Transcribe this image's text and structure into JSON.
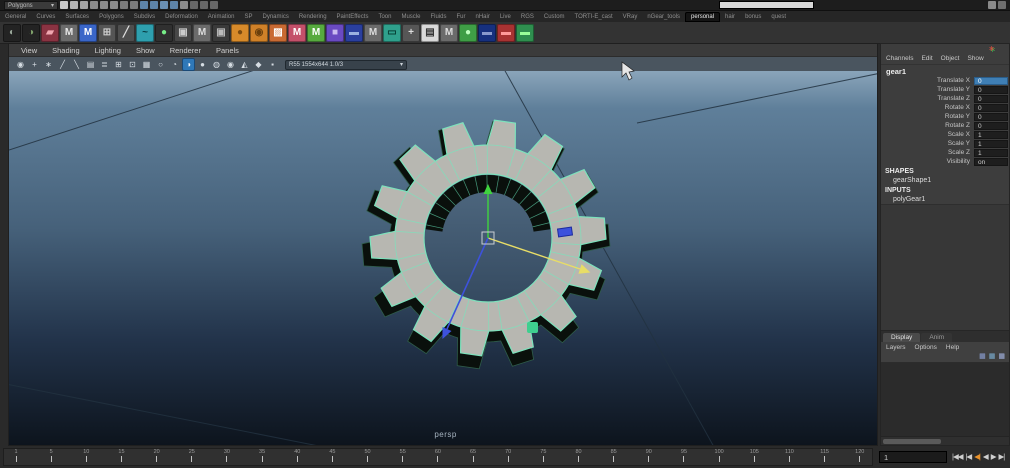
{
  "status_line": {
    "menu_set": "Polygons",
    "caret": "▾",
    "icons": [
      {
        "name": "new-scene-icon",
        "bg": "#c9c9c9"
      },
      {
        "name": "open-scene-icon",
        "bg": "#b5b5b5"
      },
      {
        "name": "save-scene-icon",
        "bg": "#a5a5a5"
      },
      {
        "name": "cut-icon",
        "bg": "#8d8d8d"
      },
      {
        "name": "copy-icon",
        "bg": "#8d8d8d"
      },
      {
        "name": "paste-icon",
        "bg": "#8d8d8d"
      },
      {
        "name": "undo-icon",
        "bg": "#7c7c7c"
      },
      {
        "name": "redo-icon",
        "bg": "#7c7c7c"
      },
      {
        "name": "snap-grid-icon",
        "bg": "#5e84a8"
      },
      {
        "name": "snap-curve-icon",
        "bg": "#5e84a8"
      },
      {
        "name": "snap-point-icon",
        "bg": "#6a8fb2"
      },
      {
        "name": "snap-view-icon",
        "bg": "#5e84a8"
      },
      {
        "name": "construction-history-icon",
        "bg": "#8d8d8d"
      },
      {
        "name": "render-current-icon",
        "bg": "#686868"
      },
      {
        "name": "ipr-render-icon",
        "bg": "#686868"
      },
      {
        "name": "render-settings-icon",
        "bg": "#686868"
      }
    ],
    "field_value": "",
    "right_icons": [
      {
        "name": "sidebar-toggle-icon",
        "bg": "#8a8a8a"
      },
      {
        "name": "hotbox-toggle-icon",
        "bg": "#6f6f6f"
      }
    ]
  },
  "shelf": {
    "tabs": [
      "General",
      "Curves",
      "Surfaces",
      "Polygons",
      "Subdivs",
      "Deformation",
      "Animation",
      "SP",
      "Dynamics",
      "Rendering",
      "PaintEffects",
      "Toon",
      "Muscle",
      "Fluids",
      "Fur",
      "nHair",
      "Live",
      "RGS",
      "Custom",
      "TORTI-E_cast",
      "VRay",
      "nGear_tools",
      "personal",
      "hair",
      "bonus",
      "quest"
    ],
    "active_tab": "personal",
    "icons": [
      {
        "name": "sphere-shelf-icon",
        "bg": "#232323",
        "fg": "#9aa89a",
        "g": "◐"
      },
      {
        "name": "shaded-sphere-shelf-icon",
        "bg": "#232323",
        "fg": "#7fa06a",
        "g": "◑"
      },
      {
        "name": "paint-effects-shelf-icon",
        "bg": "#8a3342",
        "fg": "#f0a6b0",
        "g": "▰"
      },
      {
        "name": "maya-mr-shelf-icon",
        "bg": "#6b6b6b",
        "fg": "#e8e8e8",
        "g": "M"
      },
      {
        "name": "maya-blue-shelf-icon",
        "bg": "#3a66c8",
        "fg": "#ffffff",
        "g": "M"
      },
      {
        "name": "grid-shelf-icon",
        "bg": "#555555",
        "fg": "#cccccc",
        "g": "⊞"
      },
      {
        "name": "pen-shelf-icon",
        "bg": "#4e4e4e",
        "fg": "#dddddd",
        "g": "╱"
      },
      {
        "name": "curve-shelf-icon",
        "bg": "#2e9fae",
        "fg": "#073a40",
        "g": "~"
      },
      {
        "name": "render-sphere-shelf-icon",
        "bg": "#303030",
        "fg": "#77ee88",
        "g": "●"
      },
      {
        "name": "camera-shelf-icon",
        "bg": "#474747",
        "fg": "#cccccc",
        "g": "▣"
      },
      {
        "name": "maya-gray-shelf-icon",
        "bg": "#6b6b6b",
        "fg": "#dddddd",
        "g": "M"
      },
      {
        "name": "camera-dark-shelf-icon",
        "bg": "#3a3a3a",
        "fg": "#bbbbbb",
        "g": "▣"
      },
      {
        "name": "orange-ball-shelf-icon",
        "bg": "#d78a2a",
        "fg": "#7a4a10",
        "g": "●"
      },
      {
        "name": "orange-ring-shelf-icon",
        "bg": "#d08128",
        "fg": "#6a3f0c",
        "g": "◉"
      },
      {
        "name": "poly-orange-shelf-icon",
        "bg": "#c96a33",
        "fg": "#ffffff",
        "g": "▨"
      },
      {
        "name": "maya-pink-shelf-icon",
        "bg": "#c4506a",
        "fg": "#ffffff",
        "g": "M"
      },
      {
        "name": "maya-green-shelf-icon",
        "bg": "#57aa3f",
        "fg": "#ffffff",
        "g": "M"
      },
      {
        "name": "purple-shelf-icon",
        "bg": "#6a4ac2",
        "fg": "#cabaf0",
        "g": "■"
      },
      {
        "name": "navy-shelf-icon",
        "bg": "#2a3f9e",
        "fg": "#9ab0e0",
        "g": "▬"
      },
      {
        "name": "maya-gray2-shelf-icon",
        "bg": "#6b6b6b",
        "fg": "#dddddd",
        "g": "M"
      },
      {
        "name": "teal-pill-shelf-icon",
        "bg": "#2fa08c",
        "fg": "#063f34",
        "g": "▭"
      },
      {
        "name": "plus-shelf-icon",
        "bg": "#565656",
        "fg": "#dddddd",
        "g": "+"
      },
      {
        "name": "screen-shelf-icon",
        "bg": "#d9d9d9",
        "fg": "#333333",
        "g": "▤"
      },
      {
        "name": "maya-gray3-shelf-icon",
        "bg": "#6b6b6b",
        "fg": "#dddddd",
        "g": "M"
      },
      {
        "name": "green-ball-shelf-icon",
        "bg": "#3f9e46",
        "fg": "#bfffbf",
        "g": "●"
      },
      {
        "name": "navy-bar-shelf-icon",
        "bg": "#16307e",
        "fg": "#8899cc",
        "g": "▬"
      },
      {
        "name": "red-bar-shelf-icon",
        "bg": "#a83232",
        "fg": "#ff9999",
        "g": "▬"
      },
      {
        "name": "green-bar-shelf-icon",
        "bg": "#2f8f4f",
        "fg": "#99ff99",
        "g": "▬"
      }
    ]
  },
  "panel_menu": {
    "items": [
      "View",
      "Shading",
      "Lighting",
      "Show",
      "Renderer",
      "Panels"
    ]
  },
  "panel_toolbar": {
    "icons": [
      {
        "name": "camera-lock-icon",
        "g": "◉"
      },
      {
        "name": "camera-axis-icon",
        "g": "+"
      },
      {
        "name": "bookmark-icon",
        "g": "∗"
      },
      {
        "name": "grease-pencil-icon",
        "g": "╱"
      },
      {
        "name": "grease-pencil-frame-icon",
        "g": "╲"
      },
      {
        "name": "film-gate-icon",
        "g": "▤"
      },
      {
        "name": "resolution-gate-icon",
        "g": "≣"
      },
      {
        "name": "gate-mask-icon",
        "g": "⊞"
      },
      {
        "name": "field-chart-icon",
        "g": "⊡"
      },
      {
        "name": "safe-action-icon",
        "g": "▦"
      },
      {
        "name": "wireframe-mode-icon",
        "g": "○"
      },
      {
        "name": "shaded-mode-icon",
        "g": "◔"
      },
      {
        "name": "smooth-shade-mode-icon",
        "g": "◑",
        "active": true
      },
      {
        "name": "textured-mode-icon",
        "g": "●"
      },
      {
        "name": "use-lights-icon",
        "g": "◍"
      },
      {
        "name": "shadows-icon",
        "g": "◉"
      },
      {
        "name": "xray-icon",
        "g": "◭"
      },
      {
        "name": "isolate-select-icon",
        "g": "◆"
      },
      {
        "name": "exposure-icon",
        "g": "▪"
      }
    ],
    "camera_info": "R55 1554x644 1.0/3",
    "caret": "▾"
  },
  "viewport": {
    "camera_label": "persp",
    "colors": {
      "grad_top": "#8aa5ba",
      "grad_bottom": "#0d141d",
      "grid": "#223240",
      "wire": "#7ce2bc",
      "gear_face": "#b7b7b1",
      "gear_dark": "#0a100c",
      "axis_x": "#e8dd66",
      "axis_y": "#3fd43f",
      "axis_z": "#3d52dc"
    }
  },
  "channel_box": {
    "menus": [
      "Channels",
      "Edit",
      "Object",
      "Show"
    ],
    "object_name": "gear1",
    "channels": [
      {
        "name": "Translate X",
        "value": "0",
        "selected": true
      },
      {
        "name": "Translate Y",
        "value": "0"
      },
      {
        "name": "Translate Z",
        "value": "0"
      },
      {
        "name": "Rotate X",
        "value": "0"
      },
      {
        "name": "Rotate Y",
        "value": "0"
      },
      {
        "name": "Rotate Z",
        "value": "0"
      },
      {
        "name": "Scale X",
        "value": "1"
      },
      {
        "name": "Scale Y",
        "value": "1"
      },
      {
        "name": "Scale Z",
        "value": "1"
      },
      {
        "name": "Visibility",
        "value": "on"
      }
    ],
    "shapes_label": "SHAPES",
    "shape_item": "gearShape1",
    "inputs_label": "INPUTS",
    "input_item": "polyGear1"
  },
  "layer_editor": {
    "tabs": [
      {
        "label": "Display",
        "active": true
      },
      {
        "label": "Anim",
        "active": false
      }
    ],
    "menus": [
      "Layers",
      "Options",
      "Help"
    ],
    "icons": [
      {
        "name": "new-empty-layer-icon",
        "g": "▦",
        "fg": "#8fa3d8"
      },
      {
        "name": "new-layer-from-selected-icon",
        "g": "▦",
        "fg": "#7fb3d8"
      },
      {
        "name": "new-layer-icon",
        "g": "▦",
        "fg": "#a8b8e8"
      }
    ]
  },
  "timeline": {
    "labels": [
      "1",
      "5",
      "10",
      "15",
      "20",
      "25",
      "30",
      "35",
      "40",
      "45",
      "50",
      "55",
      "60",
      "65",
      "70",
      "75",
      "80",
      "85",
      "90",
      "95",
      "100",
      "105",
      "110",
      "115",
      "120"
    ],
    "frame_field": "1"
  },
  "playback": {
    "buttons": [
      {
        "name": "go-to-start-button",
        "g": "|◀◀"
      },
      {
        "name": "step-back-frame-button",
        "g": "|◀"
      },
      {
        "name": "step-back-key-button",
        "g": "◀|",
        "hl": true
      },
      {
        "name": "play-backward-button",
        "g": "◀"
      },
      {
        "name": "play-forward-button",
        "g": "▶"
      },
      {
        "name": "go-to-end-button",
        "g": "▶|"
      }
    ]
  }
}
